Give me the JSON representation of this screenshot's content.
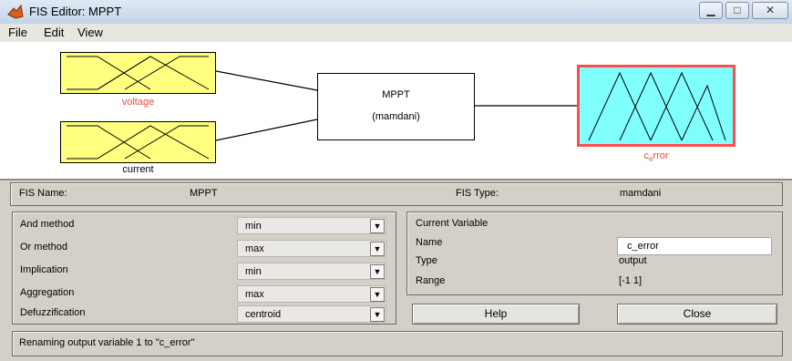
{
  "window": {
    "title": "FIS Editor: MPPT",
    "min_glyph": "▁",
    "max_glyph": "□",
    "close_glyph": "✕"
  },
  "menu": {
    "items": [
      "File",
      "Edit",
      "View"
    ]
  },
  "diagram": {
    "inputs": [
      {
        "label": "voltage"
      },
      {
        "label": "current"
      }
    ],
    "system": {
      "name": "MPPT",
      "type": "(mamdani)"
    },
    "output": {
      "label_main": "c",
      "label_sub": "e",
      "label_rest": "rror"
    },
    "colors": {
      "input_fill": "#ffff80",
      "output_fill": "#80ffff",
      "selected_border": "#ff4d4d",
      "label_red": "#e74c3c"
    }
  },
  "fis_info": {
    "name_label": "FIS Name:",
    "name_value": "MPPT",
    "type_label": "FIS Type:",
    "type_value": "mamdani"
  },
  "methods": [
    {
      "label": "And method",
      "value": "min"
    },
    {
      "label": "Or method",
      "value": "max"
    },
    {
      "label": "Implication",
      "value": "min"
    },
    {
      "label": "Aggregation",
      "value": "max"
    },
    {
      "label": "Defuzzification",
      "value": "centroid"
    }
  ],
  "current_variable": {
    "title": "Current Variable",
    "name_label": "Name",
    "name_value": "c_error",
    "type_label": "Type",
    "type_value": "output",
    "range_label": "Range",
    "range_value": "[-1 1]"
  },
  "buttons": {
    "help": "Help",
    "close": "Close"
  },
  "status": {
    "text": "Renaming output variable 1 to \"c_error\""
  }
}
